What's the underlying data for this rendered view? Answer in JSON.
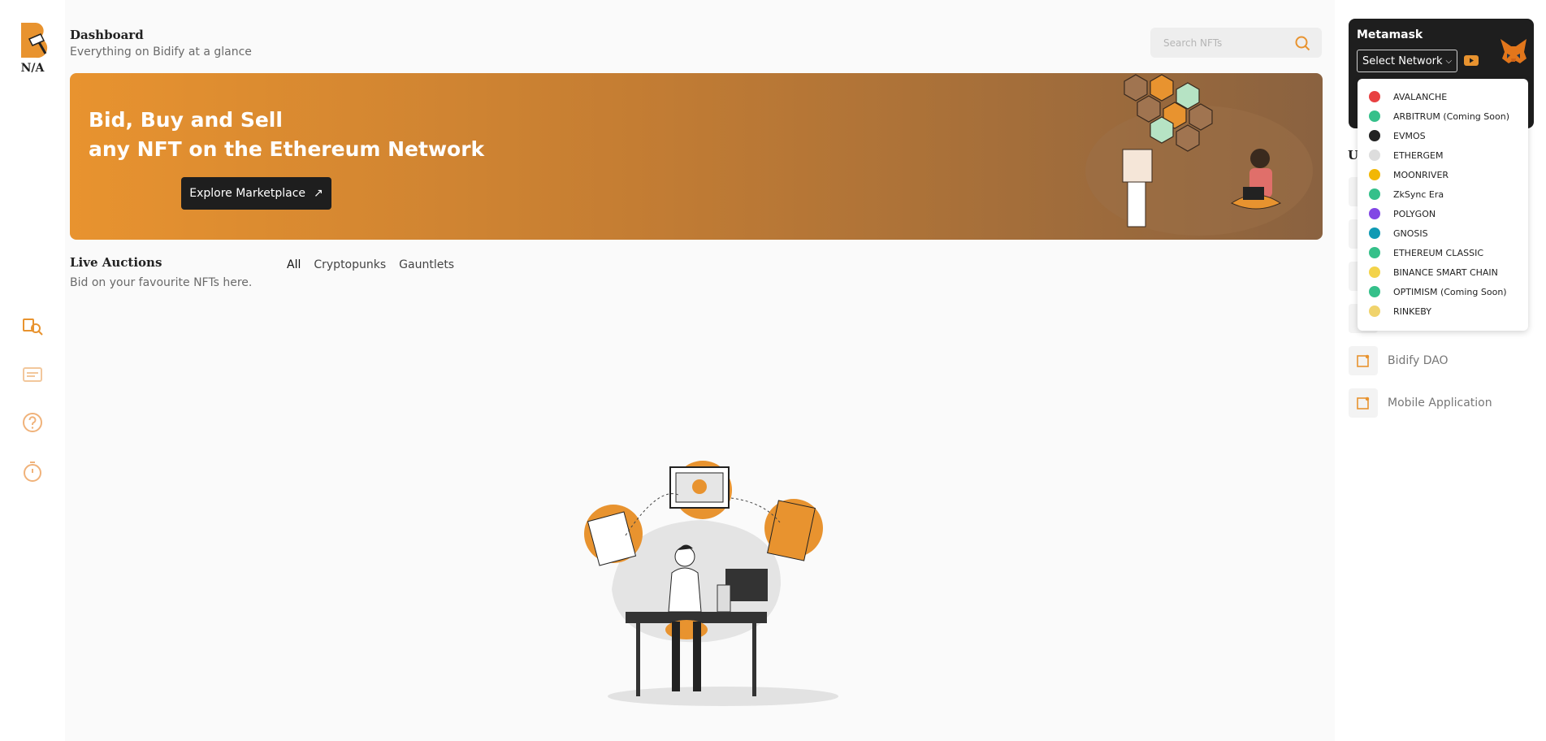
{
  "brand": {
    "logo_text": "N/A"
  },
  "header": {
    "title": "Dashboard",
    "subtitle": "Everything on Bidify at a glance",
    "search_placeholder": "Search NFTs"
  },
  "banner": {
    "line1": "Bid, Buy and Sell",
    "line2": "any NFT on the Ethereum Network",
    "cta": "Explore Marketplace"
  },
  "auctions": {
    "title": "Live Auctions",
    "subtitle": "Bid on your favourite NFTs here.",
    "filters": [
      "All",
      "Cryptopunks",
      "Gauntlets"
    ]
  },
  "metamask": {
    "title": "Metamask",
    "network_select": "Select Network",
    "networks": [
      {
        "label": "AVALANCHE",
        "color": "#e84142"
      },
      {
        "label": "ARBITRUM (Coming Soon)",
        "color": "#35c08a"
      },
      {
        "label": "EVMOS",
        "color": "#222222"
      },
      {
        "label": "ETHERGEM",
        "color": "#dddddd"
      },
      {
        "label": "MOONRIVER",
        "color": "#f2b705"
      },
      {
        "label": "ZkSync Era",
        "color": "#35c08a"
      },
      {
        "label": "POLYGON",
        "color": "#8247e5"
      },
      {
        "label": "GNOSIS",
        "color": "#0f9ab4"
      },
      {
        "label": "ETHEREUM CLASSIC",
        "color": "#35c08a"
      },
      {
        "label": "BINANCE SMART CHAIN",
        "color": "#f3d34a"
      },
      {
        "label": "OPTIMISM (Coming Soon)",
        "color": "#35c08a"
      },
      {
        "label": "RINKEBY",
        "color": "#f0d36c"
      }
    ]
  },
  "side": {
    "letter": "U",
    "links": [
      "Bidify DAO",
      "Mobile Application"
    ]
  },
  "colors": {
    "accent": "#e8932f",
    "dark": "#1e1e1e"
  }
}
